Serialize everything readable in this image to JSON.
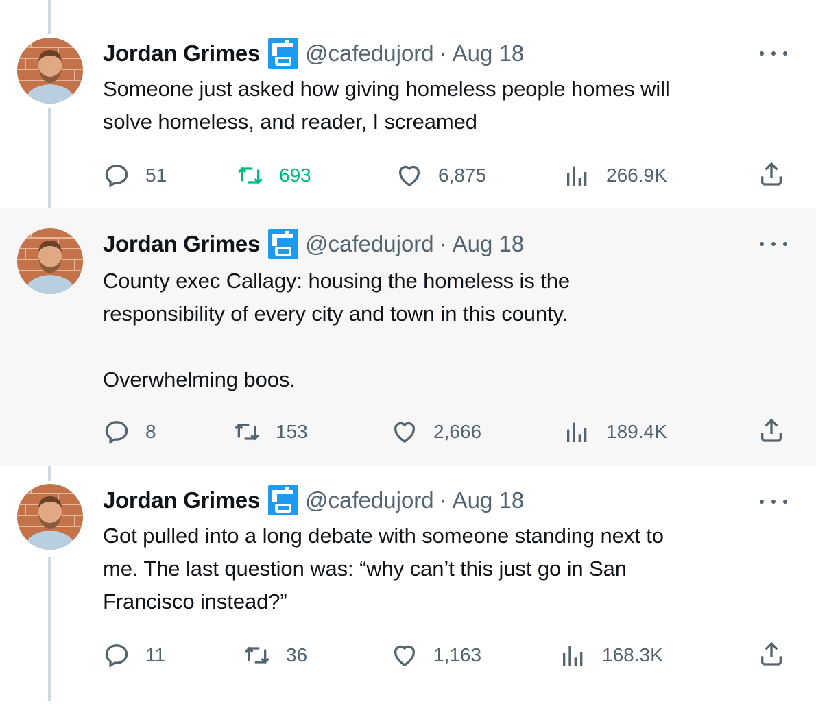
{
  "tweets": [
    {
      "author": {
        "name": "Jordan Grimes",
        "handle": "@cafedujord",
        "badge_icon": "faucet-icon"
      },
      "date": "Aug 18",
      "text": "Someone just asked how giving homeless people homes will\nsolve homeless, and reader, I screamed",
      "stats": {
        "replies": "51",
        "retweets": "693",
        "likes": "6,875",
        "views": "266.9K"
      },
      "retweeted": true,
      "highlighted": false
    },
    {
      "author": {
        "name": "Jordan Grimes",
        "handle": "@cafedujord",
        "badge_icon": "faucet-icon"
      },
      "date": "Aug 18",
      "text": "County exec Callagy: housing the homeless is the\nresponsibility of every city and town in this county.\n\nOverwhelming boos.",
      "stats": {
        "replies": "8",
        "retweets": "153",
        "likes": "2,666",
        "views": "189.4K"
      },
      "retweeted": false,
      "highlighted": true
    },
    {
      "author": {
        "name": "Jordan Grimes",
        "handle": "@cafedujord",
        "badge_icon": "faucet-icon"
      },
      "date": "Aug 18",
      "text": "Got pulled into a long debate with someone standing next to\nme.  The last question was: “why can’t this just go in San\nFrancisco instead?”",
      "stats": {
        "replies": "11",
        "retweets": "36",
        "likes": "1,163",
        "views": "168.3K"
      },
      "retweeted": false,
      "highlighted": false
    }
  ],
  "separator": "·",
  "colors": {
    "retweet_active": "#00ba7c",
    "muted": "#536471",
    "thread_line": "#cfd9de",
    "highlight_bg": "#f7f7f7",
    "badge": "#1d9bf0"
  }
}
